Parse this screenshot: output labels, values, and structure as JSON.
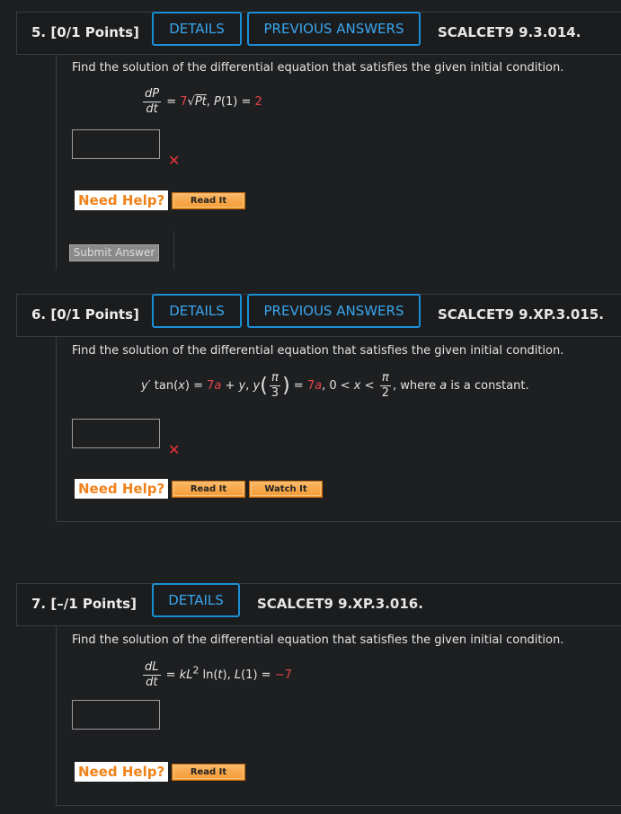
{
  "questions": [
    {
      "number": "5.",
      "points": "[0/1 Points]",
      "details": "DETAILS",
      "previous": "PREVIOUS ANSWERS",
      "ref": "SCALCET9 9.3.014.",
      "prompt": "Find the solution of the differential equation that satisfies the given initial condition.",
      "need_help": "Need Help?",
      "read_it": "Read It",
      "submit": "Submit Answer"
    },
    {
      "number": "6.",
      "points": "[0/1 Points]",
      "details": "DETAILS",
      "previous": "PREVIOUS ANSWERS",
      "ref": "SCALCET9 9.XP.3.015.",
      "prompt": "Find the solution of the differential equation that satisfies the given initial condition.",
      "need_help": "Need Help?",
      "read_it": "Read It",
      "watch_it": "Watch It"
    },
    {
      "number": "7.",
      "points": "[–/1 Points]",
      "details": "DETAILS",
      "ref": "SCALCET9 9.XP.3.016.",
      "prompt": "Find the solution of the differential equation that satisfies the given initial condition.",
      "need_help": "Need Help?",
      "read_it": "Read It"
    }
  ],
  "colors": {
    "accent": "#1a8fd6",
    "error": "#e8333a",
    "helpOrange": "#f0821a"
  },
  "icons": [
    "x-mark-icon"
  ]
}
